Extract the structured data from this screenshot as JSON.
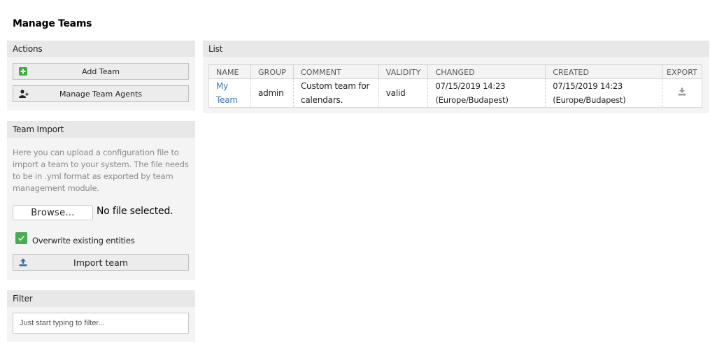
{
  "page": {
    "title": "Manage Teams"
  },
  "actions": {
    "header": "Actions",
    "add_team": {
      "label": "Add Team",
      "icon": "plus-square-icon"
    },
    "manage_agents": {
      "label": "Manage Team Agents",
      "icon": "user-plus-icon"
    }
  },
  "team_import": {
    "header": "Team Import",
    "description": "Here you can upload a configuration file to import a team to your system. The file needs to be in .yml format as exported by team management module.",
    "browse_label": "Browse…",
    "file_status": "No file selected.",
    "overwrite_label": "Overwrite existing entities",
    "overwrite_checked": true,
    "import_button": {
      "label": "Import team",
      "icon": "upload-icon"
    }
  },
  "filter": {
    "header": "Filter",
    "placeholder": "Just start typing to filter..."
  },
  "list": {
    "header": "List",
    "columns": [
      "NAME",
      "GROUP",
      "COMMENT",
      "VALIDITY",
      "CHANGED",
      "CREATED",
      "EXPORT"
    ],
    "rows": [
      {
        "name": "My Team",
        "group": "admin",
        "comment": "Custom team for calendars.",
        "validity": "valid",
        "changed_date": "07/15/2019 14:23",
        "changed_tz": "(Europe/Budapest)",
        "created_date": "07/15/2019 14:23",
        "created_tz": "(Europe/Budapest)",
        "export_icon": "download-icon"
      }
    ]
  },
  "colors": {
    "accent_green": "#4aab55",
    "link_blue": "#3a77b3",
    "icon_blue": "#2d6fa4",
    "header_bg": "#e8e8e8",
    "widget_bg": "#f4f4f4"
  }
}
